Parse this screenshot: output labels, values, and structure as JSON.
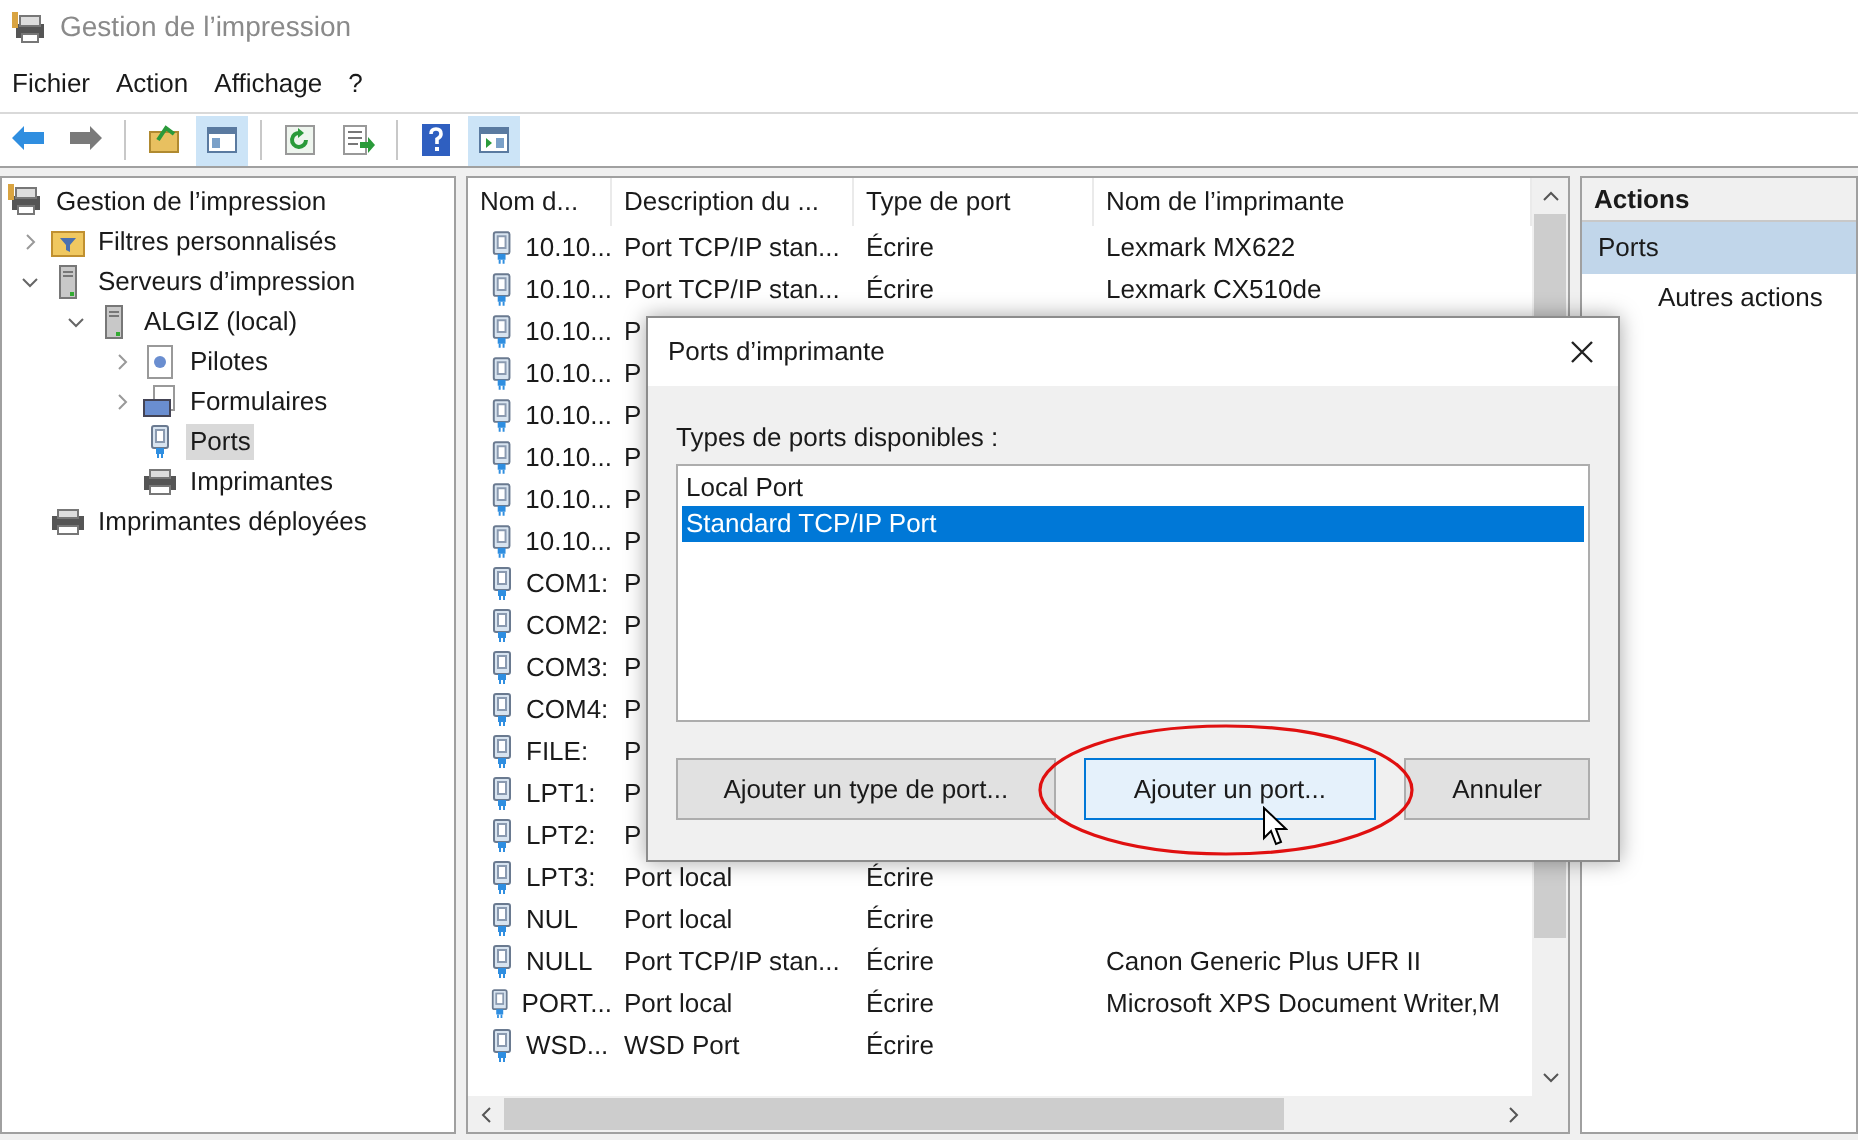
{
  "window": {
    "title": "Gestion de l’impression"
  },
  "menu": [
    "Fichier",
    "Action",
    "Affichage",
    "?"
  ],
  "toolbar": [
    {
      "kind": "back",
      "selected": false
    },
    {
      "kind": "forward",
      "selected": false
    },
    {
      "kind": "sep"
    },
    {
      "kind": "up",
      "selected": false
    },
    {
      "kind": "tree",
      "selected": true
    },
    {
      "kind": "sep"
    },
    {
      "kind": "refresh",
      "selected": false
    },
    {
      "kind": "export",
      "selected": false
    },
    {
      "kind": "sep"
    },
    {
      "kind": "help",
      "selected": false
    },
    {
      "kind": "actions",
      "selected": true
    }
  ],
  "tree": [
    {
      "label": "Gestion de l’impression",
      "kind": "root",
      "selected": false,
      "children": [
        {
          "label": "Filtres personnalisés",
          "kind": "filter",
          "expanded": false,
          "selected": false
        },
        {
          "label": "Serveurs d’impression",
          "kind": "server",
          "expanded": true,
          "selected": false,
          "children": [
            {
              "label": "ALGIZ (local)",
              "kind": "server",
              "expanded": true,
              "selected": false,
              "children": [
                {
                  "label": "Pilotes",
                  "kind": "drivers",
                  "expanded": false,
                  "selected": false
                },
                {
                  "label": "Formulaires",
                  "kind": "forms",
                  "expanded": false,
                  "selected": false
                },
                {
                  "label": "Ports",
                  "kind": "ports",
                  "selected": true
                },
                {
                  "label": "Imprimantes",
                  "kind": "printer",
                  "selected": false
                }
              ]
            }
          ]
        },
        {
          "label": "Imprimantes déployées",
          "kind": "printer",
          "selected": false
        }
      ]
    }
  ],
  "table": {
    "columns": [
      "Nom d...",
      "Description du ...",
      "Type de port",
      "Nom de l’imprimante"
    ],
    "rows": [
      {
        "name": "10.10...",
        "description": "Port TCP/IP stan...",
        "type": "Écrire",
        "printer": "Lexmark MX622"
      },
      {
        "name": "10.10...",
        "description": "Port TCP/IP stan...",
        "type": "Écrire",
        "printer": "Lexmark CX510de"
      },
      {
        "name": "10.10...",
        "description": "P"
      },
      {
        "name": "10.10...",
        "description": "P"
      },
      {
        "name": "10.10...",
        "description": "P"
      },
      {
        "name": "10.10...",
        "description": "P"
      },
      {
        "name": "10.10...",
        "description": "P"
      },
      {
        "name": "10.10...",
        "description": "P"
      },
      {
        "name": "COM1:",
        "description": "P"
      },
      {
        "name": "COM2:",
        "description": "P"
      },
      {
        "name": "COM3:",
        "description": "P"
      },
      {
        "name": "COM4:",
        "description": "P"
      },
      {
        "name": "FILE:",
        "description": "P"
      },
      {
        "name": "LPT1:",
        "description": "P"
      },
      {
        "name": "LPT2:",
        "description": "P"
      },
      {
        "name": "LPT3:",
        "description": "Port local",
        "type": "Écrire"
      },
      {
        "name": "NUL",
        "description": "Port local",
        "type": "Écrire"
      },
      {
        "name": "NULL",
        "description": "Port TCP/IP stan...",
        "type": "Écrire",
        "printer": "Canon Generic Plus UFR II"
      },
      {
        "name": "PORT...",
        "description": "Port local",
        "type": "Écrire",
        "printer": "Microsoft XPS Document Writer,M"
      },
      {
        "name": "WSD...",
        "description": "WSD Port",
        "type": "Écrire"
      }
    ]
  },
  "actions": {
    "title": "Actions",
    "section": "Ports",
    "items": [
      "Autres actions"
    ]
  },
  "dialog": {
    "title": "Ports d’imprimante",
    "label": "Types de ports disponibles :",
    "options": [
      {
        "label": "Local Port",
        "selected": false
      },
      {
        "label": "Standard TCP/IP Port",
        "selected": true
      }
    ],
    "buttons": [
      {
        "label": "Ajouter un type de port...",
        "focused": false
      },
      {
        "label": "Ajouter un port...",
        "focused": true
      },
      {
        "label": "Annuler",
        "focused": false
      }
    ]
  }
}
